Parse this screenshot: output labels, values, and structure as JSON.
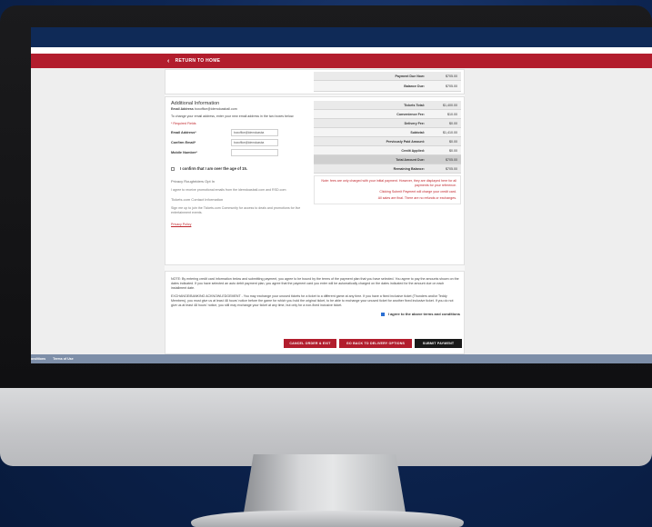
{
  "nav": {
    "return_label": "RETURN TO HOME"
  },
  "top_summary": [
    {
      "label": "Payment Due Now:",
      "value": "$705.00"
    },
    {
      "label": "Balance Due:",
      "value": "$705.00"
    }
  ],
  "additional_info": {
    "title": "Additional Information",
    "email_line_label": "Email Address",
    "email_line_value": "boxoffice@idemdoasball.com",
    "email_change_text": "To change your email address, enter your new email address in the two boxes below.",
    "required_note": "* Required Fields",
    "email_label": "Email Address*",
    "email_value": "boxoffice@idemdoasba",
    "confirm_label": "Confirm Email*",
    "confirm_value": "boxoffice@idemdoasba",
    "mobile_label": "Mobile Number*",
    "mobile_value": "",
    "age_label": "I confirm that I am over the age of 15.",
    "privacy_heading": "Privacy Roughriders Opt In",
    "privacy_text": "I agree to receive promotional emails from the idemdoasball.com and RSD.com",
    "contact_heading": "Tickets.com Contact Information",
    "contact_text": "Sign me up to join the Tickets.com Community for access to deals and promotions for live entertainment events.",
    "privacy_policy": "Privacy Policy"
  },
  "summary": {
    "rows": [
      {
        "label": "Tickets Total:",
        "value": "$1,400.00",
        "style": "normal"
      },
      {
        "label": "Convenience Fee:",
        "value": "$10.00",
        "style": "white"
      },
      {
        "label": "Delivery Fee:",
        "value": "$0.00",
        "style": "normal"
      },
      {
        "label": "Subtotal:",
        "value": "$1,410.00",
        "style": "white"
      },
      {
        "label": "Previously Paid Amount:",
        "value": "$0.00",
        "style": "normal"
      },
      {
        "label": "Credit Applied:",
        "value": "$0.00",
        "style": "white"
      },
      {
        "label": "Total Amount Due:",
        "value": "$705.00",
        "style": "dark"
      },
      {
        "label": "Remaining Balance:",
        "value": "$705.00",
        "style": "normal"
      }
    ],
    "note1": "Note: fees are only charged with your initial payment. However, they are displayed here for all payments for your reference.",
    "note2": "Clicking Submit Payment will charge your credit card.",
    "note3": "All sales are final. There are no refunds or exchanges."
  },
  "terms": {
    "p1": "NOTE: By entering credit card information below and submitting payment, you agree to be bound by the terms of the payment plan that you have selected. You agree to pay the amounts shown on the dates indicated. If you have selected an auto debit payment plan, you agree that the payment card you enter will be automatically charged on the dates indicated for the amount due on each installment date.",
    "p2": "EXCHANGE/BANKING ACKNOWLEDGEMENT - You may exchange your unused tickets for a ticket to a different game at any time. If you have a fixed inclusive ticket (Thunders and/or Teddy Members), you must give us at least 48 hours' notice before the game for which you hold the original ticket, to be able to exchange your unused ticket for another fixed inclusive ticket. If you do not give us at least 48 hours' notice, you still may exchange your ticket at any time, but only for a non-fixed inclusive ticket.",
    "agree_label": "I agree to the above terms and conditions"
  },
  "buttons": {
    "cancel": "CANCEL ORDER & EXIT",
    "back": "GO BACK TO DELIVERY OPTIONS",
    "submit": "SUBMIT PAYMENT"
  },
  "footer": {
    "item1": "onditions",
    "item2": "Terms of Use"
  },
  "colors": {
    "navy": "#0f2a57",
    "brand_red": "#b21d2d",
    "submit_dark": "#1a1a1a"
  }
}
